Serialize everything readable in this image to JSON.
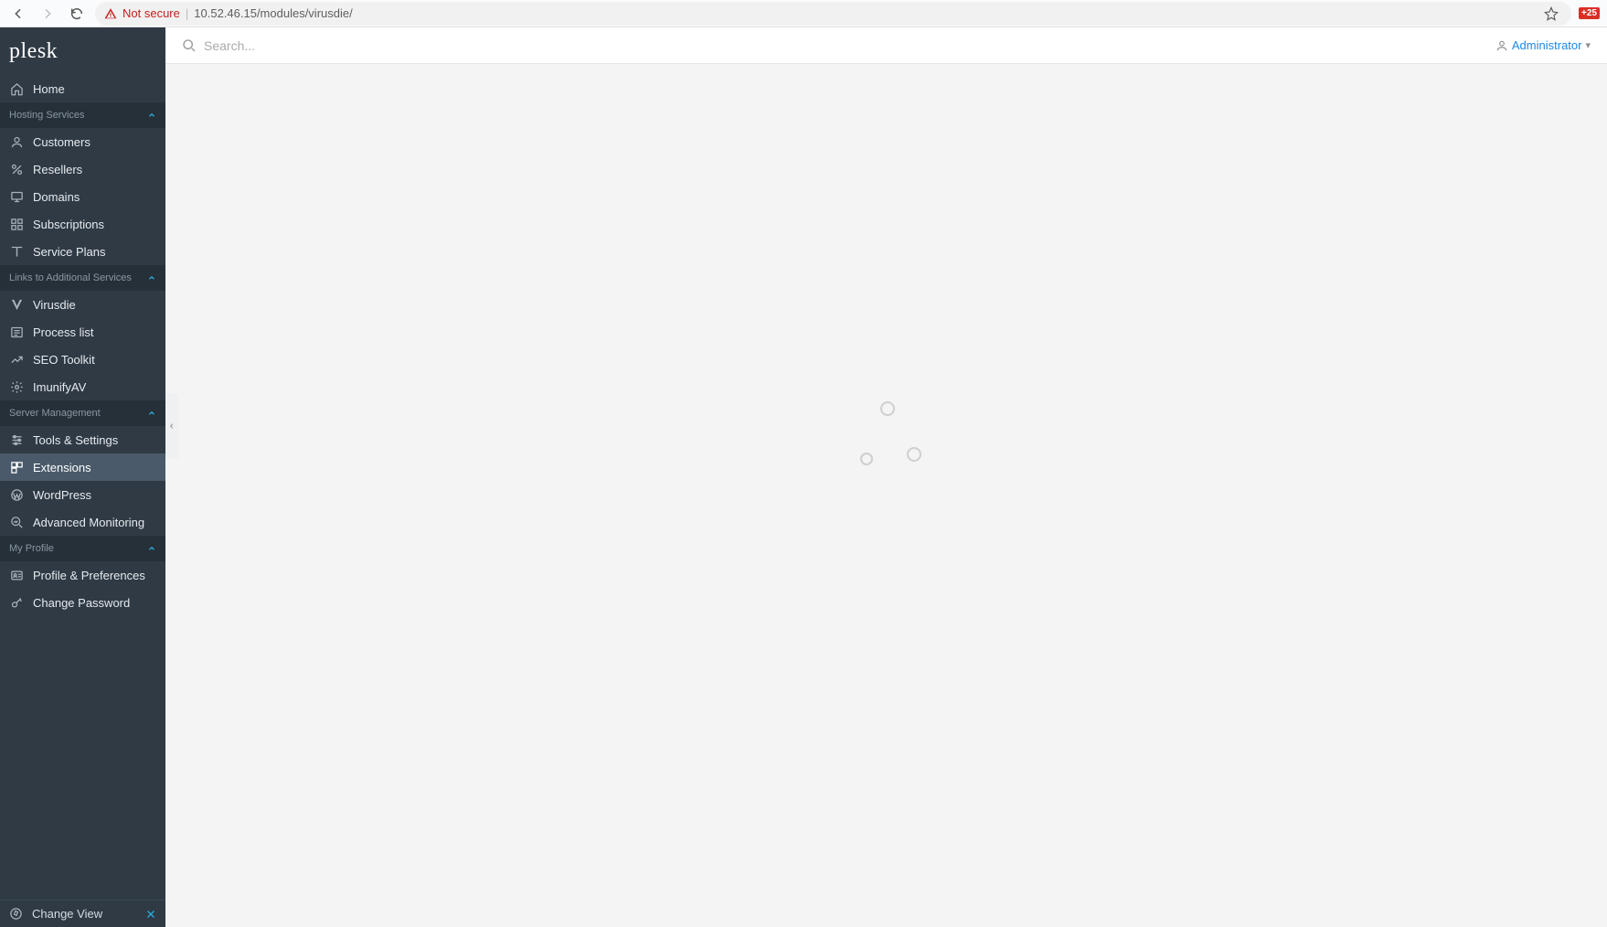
{
  "browser": {
    "not_secure": "Not secure",
    "url": "10.52.46.15/modules/virusdie/",
    "ext_badge": "+25"
  },
  "header": {
    "logo": "plesk",
    "search_placeholder": "Search...",
    "user_name": "Administrator"
  },
  "sidebar": {
    "home": "Home",
    "sections": {
      "hosting": "Hosting Services",
      "links": "Links to Additional Services",
      "server": "Server Management",
      "profile": "My Profile"
    },
    "items": {
      "customers": "Customers",
      "resellers": "Resellers",
      "domains": "Domains",
      "subscriptions": "Subscriptions",
      "service_plans": "Service Plans",
      "virusdie": "Virusdie",
      "process_list": "Process list",
      "seo_toolkit": "SEO Toolkit",
      "imunify": "ImunifyAV",
      "tools_settings": "Tools & Settings",
      "extensions": "Extensions",
      "wordpress": "WordPress",
      "adv_monitoring": "Advanced Monitoring",
      "profile_prefs": "Profile & Preferences",
      "change_password": "Change Password"
    },
    "footer": "Change View"
  }
}
